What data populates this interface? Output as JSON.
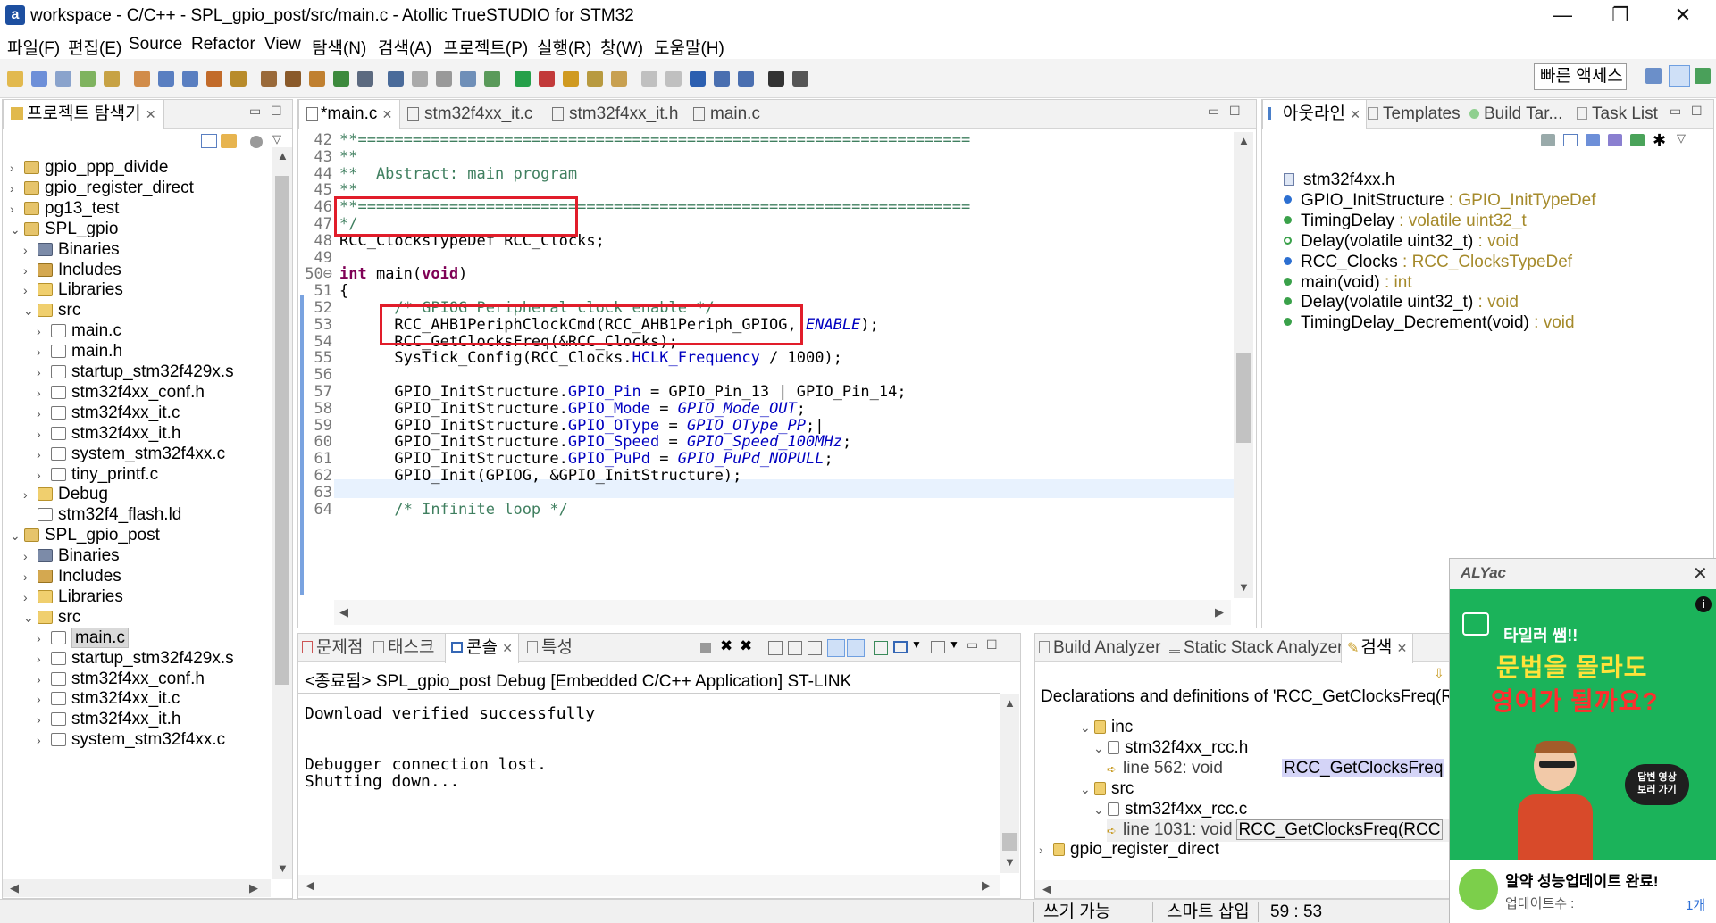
{
  "window": {
    "title": "workspace - C/C++ - SPL_gpio_post/src/main.c - Atollic TrueSTUDIO for STM32",
    "logo": "a",
    "controls": [
      "—",
      "❐",
      "✕"
    ]
  },
  "menu": [
    "파일(F)",
    "편집(E)",
    "Source",
    "Refactor",
    "View",
    "탐색(N)",
    "검색(A)",
    "프로젝트(P)",
    "실행(R)",
    "창(W)",
    "도움말(H)"
  ],
  "toolbar": {
    "quick_access": "빠른 액세스"
  },
  "project_explorer": {
    "title": "프로젝트 탐색기",
    "items": [
      {
        "label": "gpio_ppp_divide",
        "level": 0,
        "expanded": false,
        "icon": "project-icon"
      },
      {
        "label": "gpio_register_direct",
        "level": 0,
        "expanded": false,
        "icon": "project-icon"
      },
      {
        "label": "pg13_test",
        "level": 0,
        "expanded": false,
        "icon": "project-icon"
      },
      {
        "label": "SPL_gpio",
        "level": 0,
        "expanded": true,
        "icon": "project-icon"
      },
      {
        "label": "Binaries",
        "level": 1,
        "expanded": false,
        "icon": "binaries-icon"
      },
      {
        "label": "Includes",
        "level": 1,
        "expanded": false,
        "icon": "includes-icon"
      },
      {
        "label": "Libraries",
        "level": 1,
        "expanded": false,
        "icon": "folder-icon"
      },
      {
        "label": "src",
        "level": 1,
        "expanded": true,
        "icon": "folder-icon"
      },
      {
        "label": "main.c",
        "level": 2,
        "expanded": false,
        "icon": "c-file-icon"
      },
      {
        "label": "main.h",
        "level": 2,
        "expanded": false,
        "icon": "h-file-icon"
      },
      {
        "label": "startup_stm32f429x.s",
        "level": 2,
        "expanded": false,
        "icon": "file-icon"
      },
      {
        "label": "stm32f4xx_conf.h",
        "level": 2,
        "expanded": false,
        "icon": "h-file-icon"
      },
      {
        "label": "stm32f4xx_it.c",
        "level": 2,
        "expanded": false,
        "icon": "c-file-icon"
      },
      {
        "label": "stm32f4xx_it.h",
        "level": 2,
        "expanded": false,
        "icon": "h-file-icon"
      },
      {
        "label": "system_stm32f4xx.c",
        "level": 2,
        "expanded": false,
        "icon": "c-file-icon"
      },
      {
        "label": "tiny_printf.c",
        "level": 2,
        "expanded": false,
        "icon": "c-file-icon"
      },
      {
        "label": "Debug",
        "level": 1,
        "expanded": false,
        "icon": "folder-icon"
      },
      {
        "label": "stm32f4_flash.ld",
        "level": 1,
        "expanded": null,
        "icon": "file-icon"
      },
      {
        "label": "SPL_gpio_post",
        "level": 0,
        "expanded": true,
        "icon": "project-icon"
      },
      {
        "label": "Binaries",
        "level": 1,
        "expanded": false,
        "icon": "binaries-icon"
      },
      {
        "label": "Includes",
        "level": 1,
        "expanded": false,
        "icon": "includes-icon"
      },
      {
        "label": "Libraries",
        "level": 1,
        "expanded": false,
        "icon": "folder-icon"
      },
      {
        "label": "src",
        "level": 1,
        "expanded": true,
        "icon": "folder-icon"
      },
      {
        "label": "main.c",
        "level": 2,
        "expanded": false,
        "icon": "c-file-icon",
        "selected": true
      },
      {
        "label": "startup_stm32f429x.s",
        "level": 2,
        "expanded": false,
        "icon": "file-icon"
      },
      {
        "label": "stm32f4xx_conf.h",
        "level": 2,
        "expanded": false,
        "icon": "h-file-icon"
      },
      {
        "label": "stm32f4xx_it.c",
        "level": 2,
        "expanded": false,
        "icon": "c-file-icon"
      },
      {
        "label": "stm32f4xx_it.h",
        "level": 2,
        "expanded": false,
        "icon": "h-file-icon"
      },
      {
        "label": "system_stm32f4xx.c",
        "level": 2,
        "expanded": false,
        "icon": "c-file-icon"
      }
    ]
  },
  "editor": {
    "tabs": [
      {
        "label": "*main.c",
        "active": true,
        "closable": true
      },
      {
        "label": "stm32f4xx_it.c"
      },
      {
        "label": "stm32f4xx_it.h"
      },
      {
        "label": "main.c"
      }
    ],
    "lines": [
      {
        "n": "42",
        "parts": [
          [
            "cm",
            "**==================================================================="
          ]
        ]
      },
      {
        "n": "43",
        "parts": [
          [
            "cm",
            "**"
          ]
        ]
      },
      {
        "n": "44",
        "parts": [
          [
            "cm",
            "**  Abstract: main program"
          ]
        ]
      },
      {
        "n": "45",
        "parts": [
          [
            "cm",
            "**"
          ]
        ]
      },
      {
        "n": "46",
        "parts": [
          [
            "cm",
            "**==================================================================="
          ]
        ]
      },
      {
        "n": "47",
        "parts": [
          [
            "cm",
            "*/"
          ]
        ]
      },
      {
        "n": "48",
        "parts": [
          [
            "",
            "RCC_ClocksTypeDef RCC_Clocks;"
          ]
        ]
      },
      {
        "n": "49",
        "parts": [
          [
            "",
            ""
          ]
        ]
      },
      {
        "n": "50⊖",
        "parts": [
          [
            "kw",
            "int"
          ],
          [
            "",
            " main("
          ],
          [
            "kw",
            "void"
          ],
          [
            "",
            ")"
          ]
        ]
      },
      {
        "n": "51",
        "parts": [
          [
            "",
            "{"
          ]
        ]
      },
      {
        "n": "52",
        "parts": [
          [
            "cm",
            "      /* GPIOG Peripheral clock enable */"
          ]
        ]
      },
      {
        "n": "53",
        "parts": [
          [
            "",
            "      RCC_AHB1PeriphClockCmd(RCC_AHB1Periph_GPIOG, "
          ],
          [
            "it",
            "ENABLE"
          ],
          [
            "",
            ");"
          ]
        ]
      },
      {
        "n": "54",
        "parts": [
          [
            "",
            "      RCC_GetClocksFreq(&RCC_Clocks);"
          ]
        ]
      },
      {
        "n": "55",
        "parts": [
          [
            "",
            "      SysTick_Config(RCC_Clocks."
          ],
          [
            "fld",
            "HCLK_Frequency"
          ],
          [
            "",
            " / 1000);"
          ]
        ]
      },
      {
        "n": "56",
        "parts": [
          [
            "",
            ""
          ]
        ]
      },
      {
        "n": "57",
        "parts": [
          [
            "",
            "      GPIO_InitStructure."
          ],
          [
            "fld",
            "GPIO_Pin"
          ],
          [
            "",
            " = GPIO_Pin_13 | GPIO_Pin_14;"
          ]
        ]
      },
      {
        "n": "58",
        "parts": [
          [
            "",
            "      GPIO_InitStructure."
          ],
          [
            "fld",
            "GPIO_Mode"
          ],
          [
            "",
            " = "
          ],
          [
            "it",
            "GPIO_Mode_OUT"
          ],
          [
            "",
            ";"
          ]
        ]
      },
      {
        "n": "59",
        "parts": [
          [
            "",
            "      GPIO_InitStructure."
          ],
          [
            "fld",
            "GPIO_OType"
          ],
          [
            "",
            " = "
          ],
          [
            "it",
            "GPIO_OType_PP"
          ],
          [
            "",
            ";|"
          ]
        ]
      },
      {
        "n": "60",
        "parts": [
          [
            "",
            "      GPIO_InitStructure."
          ],
          [
            "fld",
            "GPIO_Speed"
          ],
          [
            "",
            " = "
          ],
          [
            "it",
            "GPIO_Speed_100MHz"
          ],
          [
            "",
            ";"
          ]
        ]
      },
      {
        "n": "61",
        "parts": [
          [
            "",
            "      GPIO_InitStructure."
          ],
          [
            "fld",
            "GPIO_PuPd"
          ],
          [
            "",
            " = "
          ],
          [
            "it",
            "GPIO_PuPd_NOPULL"
          ],
          [
            "",
            ";"
          ]
        ]
      },
      {
        "n": "62",
        "parts": [
          [
            "",
            "      GPIO_Init(GPIOG, &GPIO_InitStructure);"
          ]
        ]
      },
      {
        "n": "63",
        "parts": [
          [
            "",
            ""
          ]
        ]
      },
      {
        "n": "64",
        "parts": [
          [
            "cm",
            "      /* Infinite loop */"
          ]
        ]
      }
    ]
  },
  "outline": {
    "tabs": [
      "아웃라인",
      "Templates",
      "Build Tar...",
      "Task List"
    ],
    "items": [
      {
        "name": "stm32f4xx.h",
        "type": "",
        "icon": "include-icon"
      },
      {
        "name": "GPIO_InitStructure",
        "type": " : GPIO_InitTypeDef",
        "icon": "variable-icon"
      },
      {
        "name": "TimingDelay",
        "type": " : volatile uint32_t",
        "icon": "static-variable-icon",
        "badge": "SV"
      },
      {
        "name": "Delay(volatile uint32_t)",
        "type": " : void",
        "icon": "function-declaration-icon"
      },
      {
        "name": "RCC_Clocks",
        "type": " : RCC_ClocksTypeDef",
        "icon": "variable-icon"
      },
      {
        "name": "main(void)",
        "type": " : int",
        "icon": "function-icon"
      },
      {
        "name": "Delay(volatile uint32_t)",
        "type": " : void",
        "icon": "function-icon"
      },
      {
        "name": "TimingDelay_Decrement(void)",
        "type": " : void",
        "icon": "function-icon"
      }
    ]
  },
  "console": {
    "tabs": [
      "문제점",
      "태스크",
      "콘솔",
      "특성"
    ],
    "header": "<종료됨> SPL_gpio_post Debug [Embedded C/C++ Application] ST-LINK",
    "lines": [
      "Download verified successfully",
      "",
      "",
      "Debugger connection lost.",
      "Shutting down..."
    ]
  },
  "search": {
    "tabs": [
      "Build Analyzer",
      "Static Stack Analyzer",
      "검색"
    ],
    "header": "Declarations and definitions of 'RCC_GetClocksFreq(RCC",
    "tree": [
      {
        "label": "inc",
        "level": 0,
        "icon": "folder-icon"
      },
      {
        "label": "stm32f4xx_rcc.h",
        "level": 1,
        "icon": "h-file-icon"
      },
      {
        "label": "line 562:  void",
        "match": "RCC_GetClocksFreq",
        "level": 2,
        "icon": "match-icon"
      },
      {
        "label": "src",
        "level": 0,
        "icon": "folder-icon"
      },
      {
        "label": "stm32f4xx_rcc.c",
        "level": 1,
        "icon": "c-file-icon"
      },
      {
        "label": "line 1031:  void",
        "match": "RCC_GetClocksFreq(RCC",
        "level": 2,
        "icon": "match-icon"
      },
      {
        "label": "gpio_register_direct",
        "level": -1,
        "icon": "project-icon"
      }
    ]
  },
  "statusbar": {
    "writable": "쓰기 가능",
    "insert_mode": "스마트 삽입",
    "position": "59 : 53"
  },
  "ad": {
    "brand": "ALYac",
    "close": "✕",
    "info": "i",
    "line1": "타일러 쌤!!",
    "line2": "문법을 몰라도",
    "line3": "영어가 될까요?",
    "button": "답변 영상 보러 가기",
    "notice_title": "알약 성능업데이트 완료!",
    "notice_sub": "업데이트수 :",
    "notice_count": "1개",
    "colors": {
      "green": "#1bb35a",
      "yellow": "#ffe23a",
      "red": "#ff2e2e"
    }
  }
}
